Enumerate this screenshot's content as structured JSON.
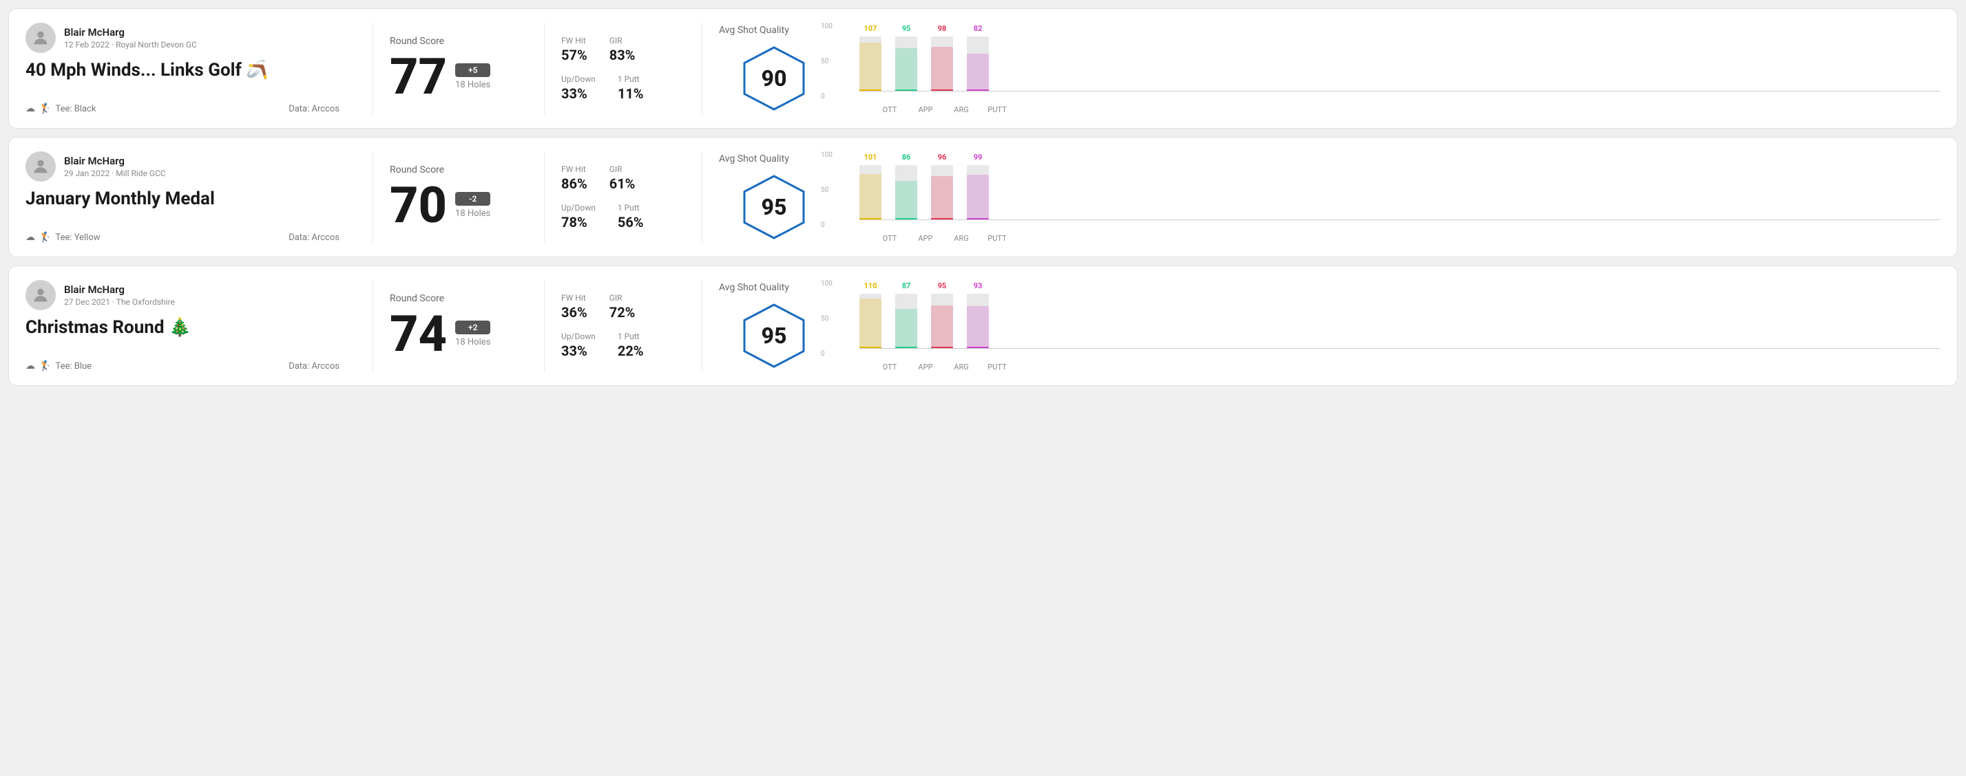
{
  "rounds": [
    {
      "id": "round1",
      "user_name": "Blair McHarg",
      "user_meta": "12 Feb 2022 · Royal North Devon GC",
      "title": "40 Mph Winds... Links Golf 🪃",
      "tee": "Black",
      "data_source": "Data: Arccos",
      "round_score_label": "Round Score",
      "score": "77",
      "badge": "+5",
      "holes": "18 Holes",
      "fw_hit_label": "FW Hit",
      "fw_hit": "57%",
      "gir_label": "GIR",
      "gir": "83%",
      "updown_label": "Up/Down",
      "updown": "33%",
      "one_putt_label": "1 Putt",
      "one_putt": "11%",
      "quality_label": "Avg Shot Quality",
      "quality": "90",
      "chart": {
        "bars": [
          {
            "label": "OTT",
            "value": 107,
            "color": "#e6b800"
          },
          {
            "label": "APP",
            "value": 95,
            "color": "#22cc88"
          },
          {
            "label": "ARG",
            "value": 98,
            "color": "#e63355"
          },
          {
            "label": "PUTT",
            "value": 82,
            "color": "#cc44cc"
          }
        ],
        "y_max": 107,
        "y_labels": [
          "100",
          "50",
          "0"
        ]
      }
    },
    {
      "id": "round2",
      "user_name": "Blair McHarg",
      "user_meta": "29 Jan 2022 · Mill Ride GCC",
      "title": "January Monthly Medal",
      "tee": "Yellow",
      "data_source": "Data: Arccos",
      "round_score_label": "Round Score",
      "score": "70",
      "badge": "-2",
      "holes": "18 Holes",
      "fw_hit_label": "FW Hit",
      "fw_hit": "86%",
      "gir_label": "GIR",
      "gir": "61%",
      "updown_label": "Up/Down",
      "updown": "78%",
      "one_putt_label": "1 Putt",
      "one_putt": "56%",
      "quality_label": "Avg Shot Quality",
      "quality": "95",
      "chart": {
        "bars": [
          {
            "label": "OTT",
            "value": 101,
            "color": "#e6b800"
          },
          {
            "label": "APP",
            "value": 86,
            "color": "#22cc88"
          },
          {
            "label": "ARG",
            "value": 96,
            "color": "#e63355"
          },
          {
            "label": "PUTT",
            "value": 99,
            "color": "#cc44cc"
          }
        ],
        "y_max": 101,
        "y_labels": [
          "100",
          "50",
          "0"
        ]
      }
    },
    {
      "id": "round3",
      "user_name": "Blair McHarg",
      "user_meta": "27 Dec 2021 · The Oxfordshire",
      "title": "Christmas Round 🎄",
      "tee": "Blue",
      "data_source": "Data: Arccos",
      "round_score_label": "Round Score",
      "score": "74",
      "badge": "+2",
      "holes": "18 Holes",
      "fw_hit_label": "FW Hit",
      "fw_hit": "36%",
      "gir_label": "GIR",
      "gir": "72%",
      "updown_label": "Up/Down",
      "updown": "33%",
      "one_putt_label": "1 Putt",
      "one_putt": "22%",
      "quality_label": "Avg Shot Quality",
      "quality": "95",
      "chart": {
        "bars": [
          {
            "label": "OTT",
            "value": 110,
            "color": "#e6b800"
          },
          {
            "label": "APP",
            "value": 87,
            "color": "#22cc88"
          },
          {
            "label": "ARG",
            "value": 95,
            "color": "#e63355"
          },
          {
            "label": "PUTT",
            "value": 93,
            "color": "#cc44cc"
          }
        ],
        "y_max": 110,
        "y_labels": [
          "100",
          "50",
          "0"
        ]
      }
    }
  ]
}
